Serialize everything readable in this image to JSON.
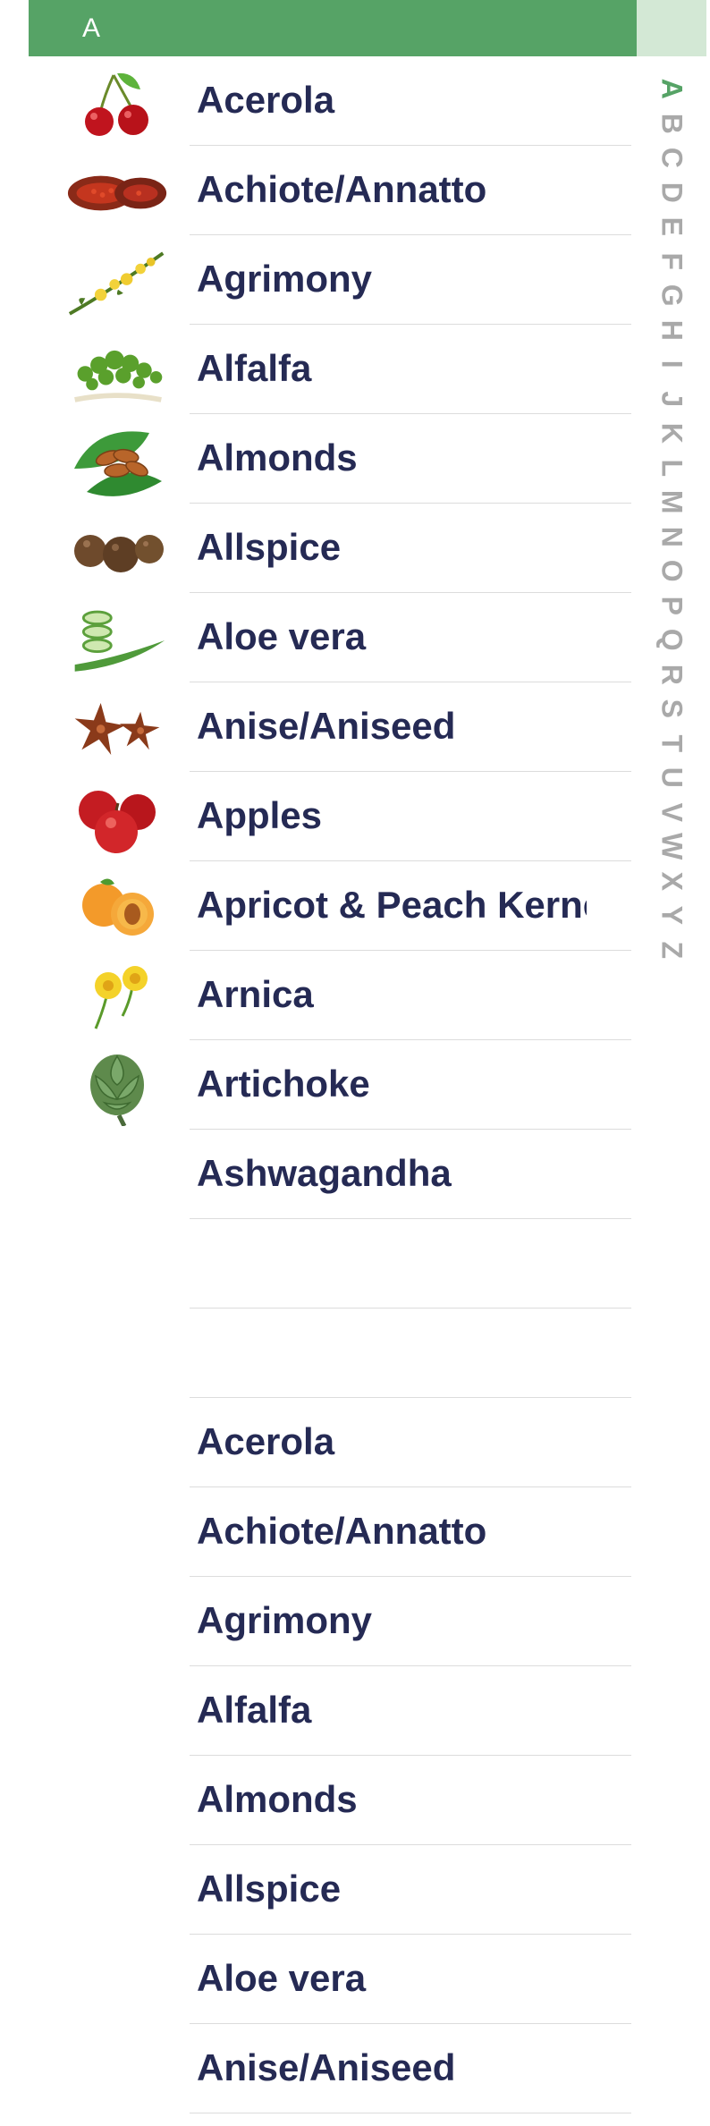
{
  "header": {
    "letter": "A"
  },
  "index": {
    "active": "A",
    "letters": [
      "A",
      "B",
      "C",
      "D",
      "E",
      "F",
      "G",
      "H",
      "I",
      "J",
      "K",
      "L",
      "M",
      "N",
      "O",
      "P",
      "Q",
      "R",
      "S",
      "T",
      "U",
      "V",
      "W",
      "X",
      "Y",
      "Z"
    ]
  },
  "items": [
    {
      "label": "Acerola",
      "icon": "cherry-icon"
    },
    {
      "label": "Achiote/Annatto",
      "icon": "annatto-pod-icon"
    },
    {
      "label": "Agrimony",
      "icon": "agrimony-flower-icon"
    },
    {
      "label": "Alfalfa",
      "icon": "alfalfa-sprouts-icon"
    },
    {
      "label": "Almonds",
      "icon": "almonds-icon"
    },
    {
      "label": "Allspice",
      "icon": "allspice-berries-icon"
    },
    {
      "label": "Aloe vera",
      "icon": "aloe-vera-icon"
    },
    {
      "label": "Anise/Aniseed",
      "icon": "star-anise-icon"
    },
    {
      "label": "Apples",
      "icon": "apples-icon"
    },
    {
      "label": "Apricot & Peach Kernel",
      "icon": "apricot-icon"
    },
    {
      "label": "Arnica",
      "icon": "arnica-flower-icon"
    },
    {
      "label": "Artichoke",
      "icon": "artichoke-icon"
    },
    {
      "label": "Ashwagandha",
      "icon": ""
    },
    {
      "label": "",
      "icon": ""
    },
    {
      "label": "",
      "icon": ""
    },
    {
      "label": "Acerola",
      "icon": ""
    },
    {
      "label": "Achiote/Annatto",
      "icon": ""
    },
    {
      "label": "Agrimony",
      "icon": ""
    },
    {
      "label": "Alfalfa",
      "icon": ""
    },
    {
      "label": "Almonds",
      "icon": ""
    },
    {
      "label": "Allspice",
      "icon": ""
    },
    {
      "label": "Aloe vera",
      "icon": ""
    },
    {
      "label": "Anise/Aniseed",
      "icon": ""
    }
  ]
}
